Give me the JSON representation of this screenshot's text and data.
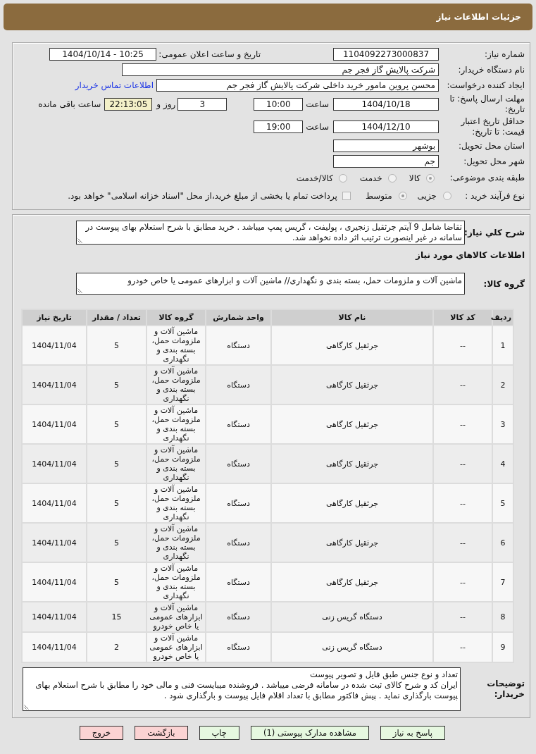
{
  "header": {
    "title": "جزئیات اطلاعات نیاز"
  },
  "details": {
    "need_number": {
      "label": "شماره نیاز:",
      "value": "1104092273000837"
    },
    "announcement": {
      "label": "تاریخ و ساعت اعلان عمومی:",
      "value": "1404/10/14 - 10:25"
    },
    "buyer": {
      "label": "نام دستگاه خریدار:",
      "value": "شرکت پالایش گاز فجر جم"
    },
    "requester": {
      "label": "ایجاد کننده درخواست:",
      "value": "محسن پروین مامور خرید داخلی شرکت پالایش گاز فجر جم",
      "contact_link": "اطلاعات تماس خریدار"
    },
    "response_deadline": {
      "label": "مهلت ارسال پاسخ: تا تاریخ:",
      "date": "1404/10/18",
      "time_label": "ساعت",
      "time": "10:00",
      "days": "3",
      "days_label": "روز و",
      "remaining": "22:13:05",
      "remaining_label": "ساعت باقی مانده"
    },
    "price_validity": {
      "label": "حداقل تاریخ اعتبار قیمت: تا تاریخ:",
      "date": "1404/12/10",
      "time_label": "ساعت",
      "time": "19:00"
    },
    "province": {
      "label": "استان محل تحویل:",
      "value": "بوشهر"
    },
    "city": {
      "label": "شهر محل تحویل:",
      "value": "جم"
    },
    "category": {
      "label": "طبقه بندی موضوعی:",
      "options": [
        {
          "label": "کالا",
          "selected": true
        },
        {
          "label": "خدمت",
          "selected": false
        },
        {
          "label": "کالا/خدمت",
          "selected": false
        }
      ]
    },
    "purchase_process": {
      "label": "نوع فرآیند خرید :",
      "options": [
        {
          "label": "جزیی",
          "selected": false
        },
        {
          "label": "متوسط",
          "selected": true
        }
      ],
      "treasury_payment": {
        "label": "پرداخت تمام یا بخشی از مبلغ خرید،از محل \"اسناد خزانه اسلامی\" خواهد بود.",
        "checked": false
      }
    }
  },
  "description": {
    "label": "شرح کلي نياز:",
    "value": "تقاضا شامل 9 آیتم جرثقیل زنجیری ، پولیفت ، گریس پمپ میباشد . خرید مطابق با شرح استعلام بهای پیوست در سامانه در غیر اینصورت ترتیب اثر داده نخواهد شد."
  },
  "goods": {
    "title": "اطلاعات کالاهاي مورد نياز",
    "group_label": "گروه کالا:",
    "group_value": "ماشین آلات و ملزومات حمل، بسته بندی و نگهداری// ماشین آلات و ابزارهای عمومی یا خاص خودرو"
  },
  "table": {
    "columns": [
      "ردیف",
      "کد کالا",
      "نام کالا",
      "واحد شمارش",
      "گروه کالا",
      "تعداد / مقدار",
      "تاریخ نیاز"
    ],
    "rows": [
      [
        "1",
        "--",
        "جرثقیل کارگاهی",
        "دستگاه",
        "ماشین آلات و ملزومات حمل، بسته بندی و نگهداری",
        "5",
        "1404/11/04"
      ],
      [
        "2",
        "--",
        "جرثقیل کارگاهی",
        "دستگاه",
        "ماشین آلات و ملزومات حمل، بسته بندی و نگهداری",
        "5",
        "1404/11/04"
      ],
      [
        "3",
        "--",
        "جرثقیل کارگاهی",
        "دستگاه",
        "ماشین آلات و ملزومات حمل، بسته بندی و نگهداری",
        "5",
        "1404/11/04"
      ],
      [
        "4",
        "--",
        "جرثقیل کارگاهی",
        "دستگاه",
        "ماشین آلات و ملزومات حمل، بسته بندی و نگهداری",
        "5",
        "1404/11/04"
      ],
      [
        "5",
        "--",
        "جرثقیل کارگاهی",
        "دستگاه",
        "ماشین آلات و ملزومات حمل، بسته بندی و نگهداری",
        "5",
        "1404/11/04"
      ],
      [
        "6",
        "--",
        "جرثقیل کارگاهی",
        "دستگاه",
        "ماشین آلات و ملزومات حمل، بسته بندی و نگهداری",
        "5",
        "1404/11/04"
      ],
      [
        "7",
        "--",
        "جرثقیل کارگاهی",
        "دستگاه",
        "ماشین آلات و ملزومات حمل، بسته بندی و نگهداری",
        "5",
        "1404/11/04"
      ],
      [
        "8",
        "--",
        "دستگاه گریس زنی",
        "دستگاه",
        "ماشین آلات و ابزارهای عمومی یا خاص خودرو",
        "15",
        "1404/11/04"
      ],
      [
        "9",
        "--",
        "دستگاه گریس زنی",
        "دستگاه",
        "ماشین آلات و ابزارهای عمومی یا خاص خودرو",
        "2",
        "1404/11/04"
      ]
    ]
  },
  "buyer_notes": {
    "label": "توضیحات خریدار:",
    "lines": [
      "تعداد و نوع جنس طبق فایل و تصویر پیوست",
      "ایران کد و شرح کالای ثبت شده در سامانه فرضی میباشد . فروشنده میبایست فنی و مالی خود را مطابق با شرح استعلام بهای پیوست بارگذاری نماید . پیش فاکتور مطابق با تعداد اقلام فایل پیوست و بارگذاری شود ."
    ]
  },
  "buttons": [
    {
      "label": "پاسخ به نیاز",
      "kind": "action"
    },
    {
      "label": "مشاهده مدارک پیوستی (1)",
      "kind": "action"
    },
    {
      "label": "چاپ",
      "kind": "action"
    },
    {
      "label": "بازگشت",
      "kind": "exit"
    },
    {
      "label": "خروج",
      "kind": "exit"
    }
  ]
}
